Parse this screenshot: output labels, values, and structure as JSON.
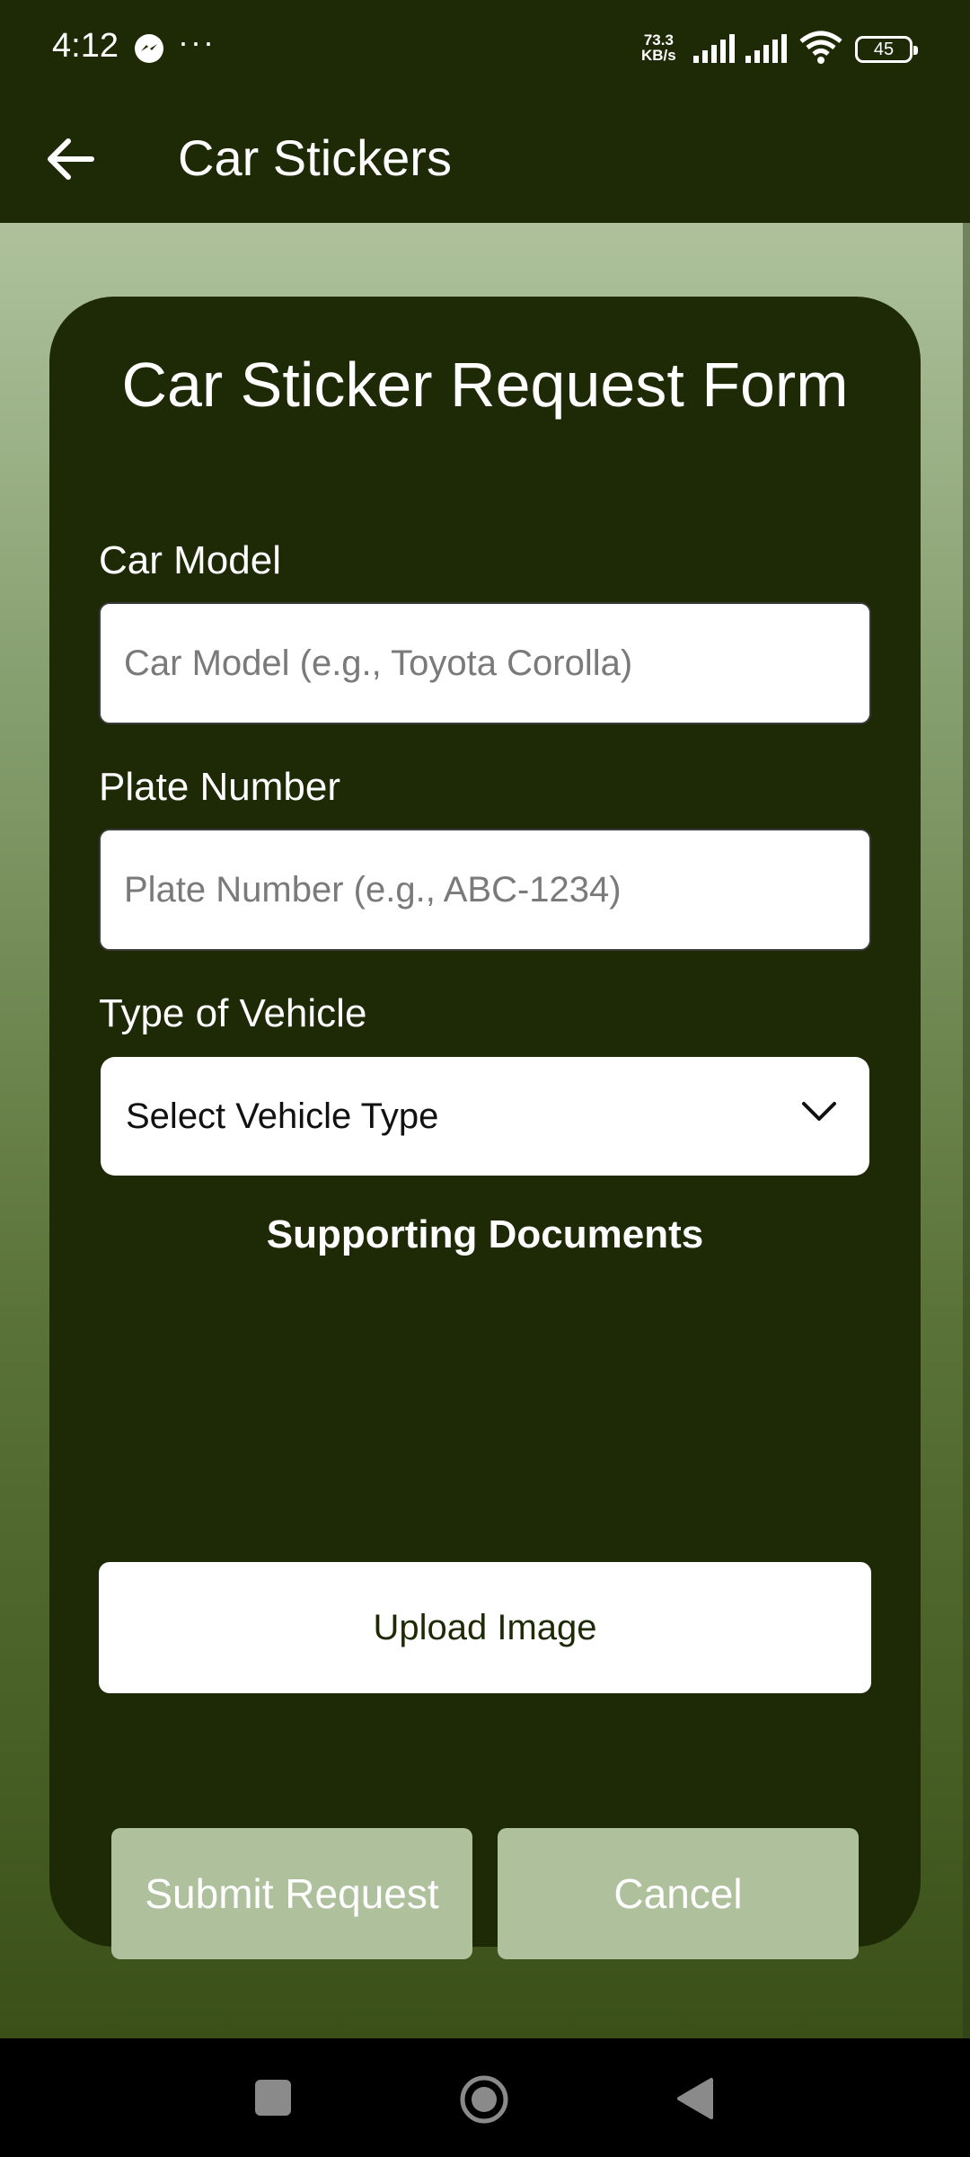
{
  "status_bar": {
    "time": "4:12",
    "more": "···",
    "net_speed_value": "73.3",
    "net_speed_unit": "KB/s",
    "battery": "45"
  },
  "app_bar": {
    "title": "Car Stickers",
    "back_icon": "arrow-left-icon"
  },
  "form": {
    "title": "Car Sticker Request Form",
    "car_model": {
      "label": "Car Model",
      "placeholder": "Car Model (e.g., Toyota Corolla)",
      "value": ""
    },
    "plate_number": {
      "label": "Plate Number",
      "placeholder": "Plate Number (e.g., ABC-1234)",
      "value": ""
    },
    "vehicle_type": {
      "label": "Type of Vehicle",
      "selected": "Select Vehicle Type"
    },
    "documents_heading": "Supporting Documents",
    "upload_label": "Upload Image",
    "submit_label": "Submit Request",
    "cancel_label": "Cancel"
  },
  "colors": {
    "dark_green": "#1e2a06",
    "light_green": "#aec19c",
    "white": "#ffffff"
  },
  "nav_bar": {
    "icons": [
      "recents-icon",
      "home-icon",
      "back-triangle-icon"
    ]
  }
}
